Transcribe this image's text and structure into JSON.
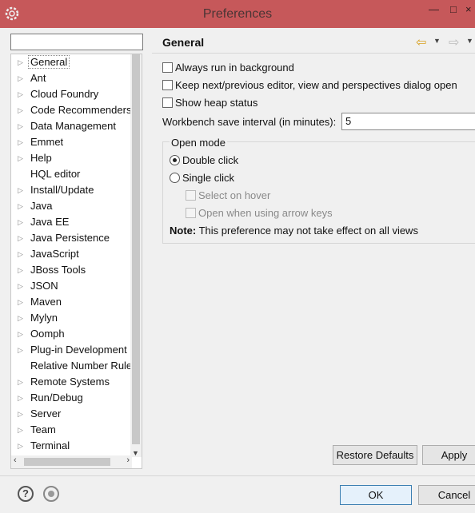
{
  "window": {
    "title": "Preferences"
  },
  "filter": {
    "value": ""
  },
  "tree": {
    "items": [
      {
        "label": "General",
        "expandable": true,
        "selected": true
      },
      {
        "label": "Ant",
        "expandable": true
      },
      {
        "label": "Cloud Foundry",
        "expandable": true
      },
      {
        "label": "Code Recommenders",
        "expandable": true
      },
      {
        "label": "Data Management",
        "expandable": true
      },
      {
        "label": "Emmet",
        "expandable": true
      },
      {
        "label": "Help",
        "expandable": true
      },
      {
        "label": "HQL editor",
        "expandable": false
      },
      {
        "label": "Install/Update",
        "expandable": true
      },
      {
        "label": "Java",
        "expandable": true
      },
      {
        "label": "Java EE",
        "expandable": true
      },
      {
        "label": "Java Persistence",
        "expandable": true
      },
      {
        "label": "JavaScript",
        "expandable": true
      },
      {
        "label": "JBoss Tools",
        "expandable": true
      },
      {
        "label": "JSON",
        "expandable": true
      },
      {
        "label": "Maven",
        "expandable": true
      },
      {
        "label": "Mylyn",
        "expandable": true
      },
      {
        "label": "Oomph",
        "expandable": true
      },
      {
        "label": "Plug-in Development",
        "expandable": true
      },
      {
        "label": "Relative Number Rule",
        "expandable": false
      },
      {
        "label": "Remote Systems",
        "expandable": true
      },
      {
        "label": "Run/Debug",
        "expandable": true
      },
      {
        "label": "Server",
        "expandable": true
      },
      {
        "label": "Team",
        "expandable": true
      },
      {
        "label": "Terminal",
        "expandable": true
      }
    ]
  },
  "page": {
    "title": "General",
    "always_run_bg": "Always run in background",
    "keep_next_prev": "Keep next/previous editor, view and perspectives dialog open",
    "show_heap": "Show heap status",
    "interval_label": "Workbench save interval (in minutes):",
    "interval_value": "5",
    "open_mode": {
      "legend": "Open mode",
      "double_click": "Double click",
      "single_click": "Single click",
      "select_on_hover": "Select on hover",
      "open_arrow_keys": "Open when using arrow keys",
      "note_bold": "Note:",
      "note_text": "This preference may not take effect on all views"
    }
  },
  "buttons": {
    "restore_defaults": "Restore Defaults",
    "apply": "Apply",
    "ok": "OK",
    "cancel": "Cancel"
  },
  "colors": {
    "titlebar": "#c6585a",
    "back_arrow": "#d8a020"
  }
}
